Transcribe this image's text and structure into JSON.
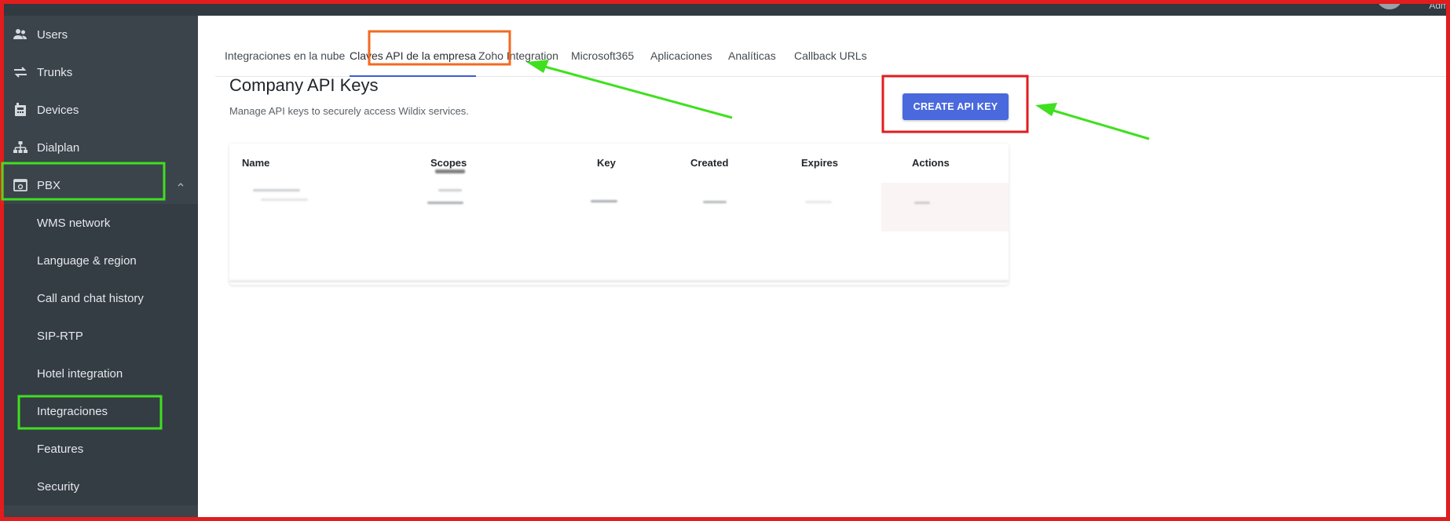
{
  "header": {
    "user_label": "Adm"
  },
  "sidebar": {
    "items": [
      {
        "label": "Users",
        "icon": "users-icon"
      },
      {
        "label": "Trunks",
        "icon": "trunks-icon"
      },
      {
        "label": "Devices",
        "icon": "devices-icon"
      },
      {
        "label": "Dialplan",
        "icon": "dialplan-icon"
      },
      {
        "label": "PBX",
        "icon": "pbx-icon",
        "expanded": true
      }
    ],
    "pbx_subitems": [
      {
        "label": "WMS network"
      },
      {
        "label": "Language & region"
      },
      {
        "label": "Call and chat history"
      },
      {
        "label": "SIP-RTP"
      },
      {
        "label": "Hotel integration"
      },
      {
        "label": "Integraciones",
        "selected": true
      },
      {
        "label": "Features"
      },
      {
        "label": "Security"
      }
    ]
  },
  "tabs": [
    {
      "label": "Integraciones en la nube"
    },
    {
      "label": "Claves API de la empresa",
      "active": true
    },
    {
      "label": "Zoho Integration"
    },
    {
      "label": "Microsoft365"
    },
    {
      "label": "Aplicaciones"
    },
    {
      "label": "Analíticas"
    },
    {
      "label": "Callback URLs"
    }
  ],
  "main": {
    "title": "Company API Keys",
    "subtitle": "Manage API keys to securely access Wildix services.",
    "create_button": "CREATE API KEY",
    "table": {
      "columns": [
        "Name",
        "Scopes",
        "Key",
        "Created",
        "Expires",
        "Actions"
      ]
    }
  },
  "colors": {
    "sidebar_bg": "#3b434b",
    "accent": "#4a69dd",
    "annotation_red": "#e11d1d",
    "annotation_green": "#3fe01f",
    "annotation_orange": "#f26a21"
  }
}
